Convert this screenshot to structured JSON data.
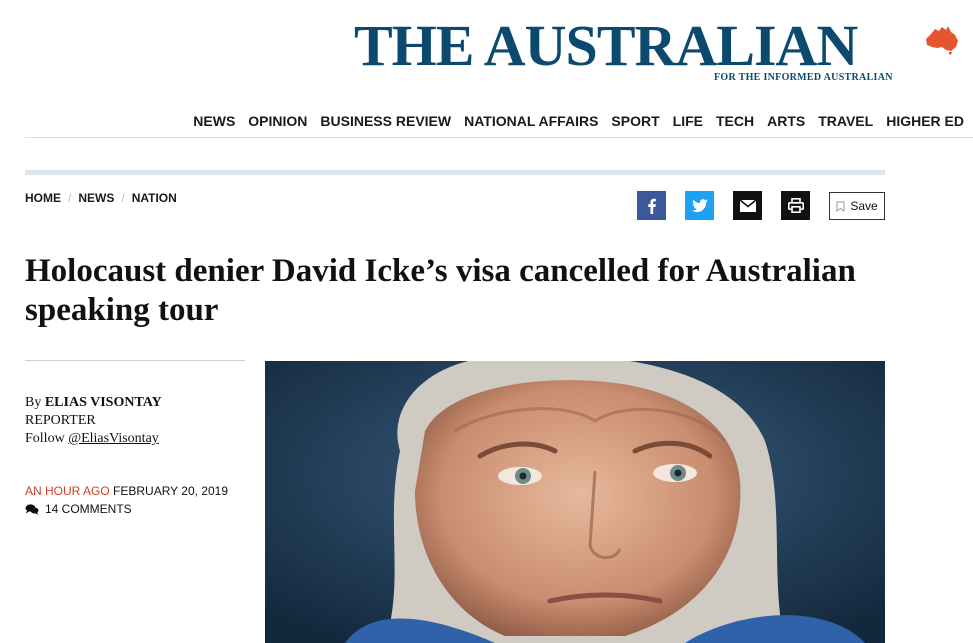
{
  "masthead": {
    "title": "THE AUSTRALIAN",
    "tagline": "FOR THE INFORMED AUSTRALIAN"
  },
  "nav": {
    "items": [
      "NEWS",
      "OPINION",
      "BUSINESS REVIEW",
      "NATIONAL AFFAIRS",
      "SPORT",
      "LIFE",
      "TECH",
      "ARTS",
      "TRAVEL",
      "HIGHER ED"
    ]
  },
  "breadcrumb": {
    "items": [
      "HOME",
      "NEWS",
      "NATION"
    ]
  },
  "share": {
    "icons": [
      "facebook-icon",
      "twitter-icon",
      "email-icon",
      "print-icon"
    ],
    "save_label": "Save"
  },
  "article": {
    "headline": "Holocaust denier David Icke’s visa cancelled for Australian speaking tour",
    "byline_prefix": "By",
    "author": "ELIAS VISONTAY",
    "role": "REPORTER",
    "follow_label": "Follow",
    "handle": "@EliasVisontay",
    "relative_time": "AN HOUR AGO",
    "date": "FEBRUARY 20, 2019",
    "comments": "14 COMMENTS"
  },
  "colors": {
    "brand": "#0b4a6e",
    "accent_red": "#d0402d",
    "map_orange": "#e4572e",
    "facebook": "#3b5998",
    "twitter": "#1da1f2"
  }
}
